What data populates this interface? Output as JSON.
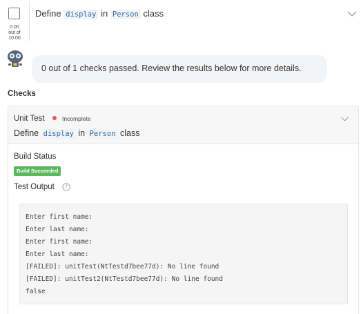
{
  "task": {
    "score_value": "0.00",
    "score_out_of": "out of",
    "score_max": "10.00",
    "title_prefix": "Define",
    "title_code1": "display",
    "title_middle": "in",
    "title_code2": "Person",
    "title_suffix": "class"
  },
  "feedback": {
    "message": "0 out of 1 checks passed. Review the results below for more details."
  },
  "checks": {
    "heading": "Checks",
    "unit_test": {
      "title": "Unit Test",
      "status": "Incomplete",
      "status_color": "#e05a4f",
      "desc_prefix": "Define",
      "desc_code1": "display",
      "desc_middle": "in",
      "desc_code2": "Person",
      "desc_suffix": "class",
      "build_status_label": "Build Status",
      "build_badge": "Build Succeeded",
      "build_badge_color": "#5cb85c",
      "test_output_label": "Test Output",
      "output_lines": [
        "Enter first name:",
        "Enter last name:",
        "Enter first name:",
        "Enter last name:",
        "[FAILED]: unitTest(NtTestd7bee77d): No line found",
        "[FAILED]: unitTest2(NtTestd7bee77d): No line found",
        "false"
      ]
    }
  }
}
